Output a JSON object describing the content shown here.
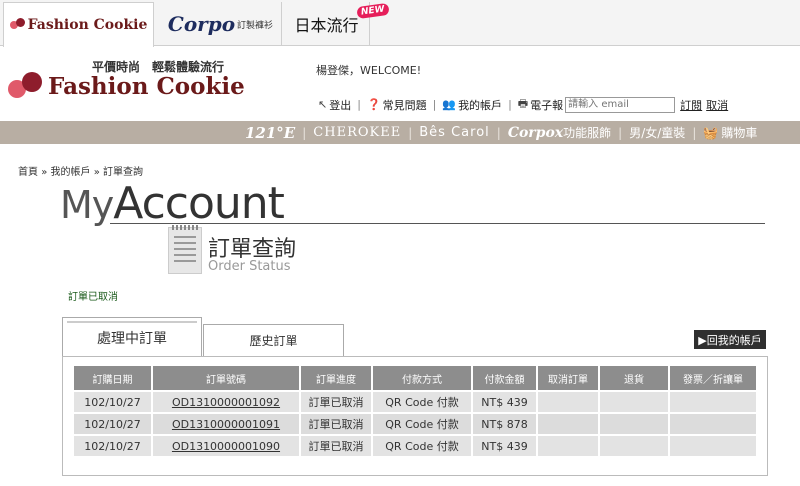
{
  "brand_tabs": {
    "fashion_cookie": "Fashion Cookie",
    "corpo": "Corpo",
    "corpo_sub": "訂製褲衫",
    "japan": "日本流行",
    "new_badge": "NEW"
  },
  "header": {
    "slogan": "平價時尚　輕鬆體驗流行",
    "logo_text": "Fashion Cookie",
    "welcome": "楊登傑，WELCOME!",
    "links": {
      "logout": "登出",
      "faq": "常見問題",
      "my_account": "我的帳戶",
      "newsletter": "電子報",
      "subscribe": "訂閱",
      "cancel": "取消"
    },
    "email_placeholder": "請輸入 email"
  },
  "nav": {
    "brand_121e": "121°E",
    "cherokee": "CHEROKEE",
    "bescarol": "Bês Carol",
    "corpox": "Corpox",
    "corpox_sub": "功能服飾",
    "gender": "男/女/童裝",
    "cart": "購物車"
  },
  "breadcrumb": {
    "home": "首頁",
    "account": "我的帳戶",
    "current": "訂單查詢",
    "sep": "»"
  },
  "page": {
    "title_my": "My",
    "title_account": "Account",
    "subtitle": "訂單查詢",
    "subtitle_en": "Order Status",
    "status_msg": "訂單已取消"
  },
  "tabs": {
    "processing": "處理中訂單",
    "history": "歷史訂單",
    "back": "▶回我的帳戶"
  },
  "table": {
    "headers": [
      "訂購日期",
      "訂單號碼",
      "訂單進度",
      "付款方式",
      "付款金額",
      "取消訂單",
      "退貨",
      "發票／折讓單"
    ],
    "rows": [
      {
        "date": "102/10/27",
        "order": "OD1310000001092",
        "status": "訂單已取消",
        "payment": "QR Code 付款",
        "amount": "NT$ 439"
      },
      {
        "date": "102/10/27",
        "order": "OD1310000001091",
        "status": "訂單已取消",
        "payment": "QR Code 付款",
        "amount": "NT$ 878"
      },
      {
        "date": "102/10/27",
        "order": "OD1310000001090",
        "status": "訂單已取消",
        "payment": "QR Code 付款",
        "amount": "NT$ 439"
      }
    ]
  }
}
